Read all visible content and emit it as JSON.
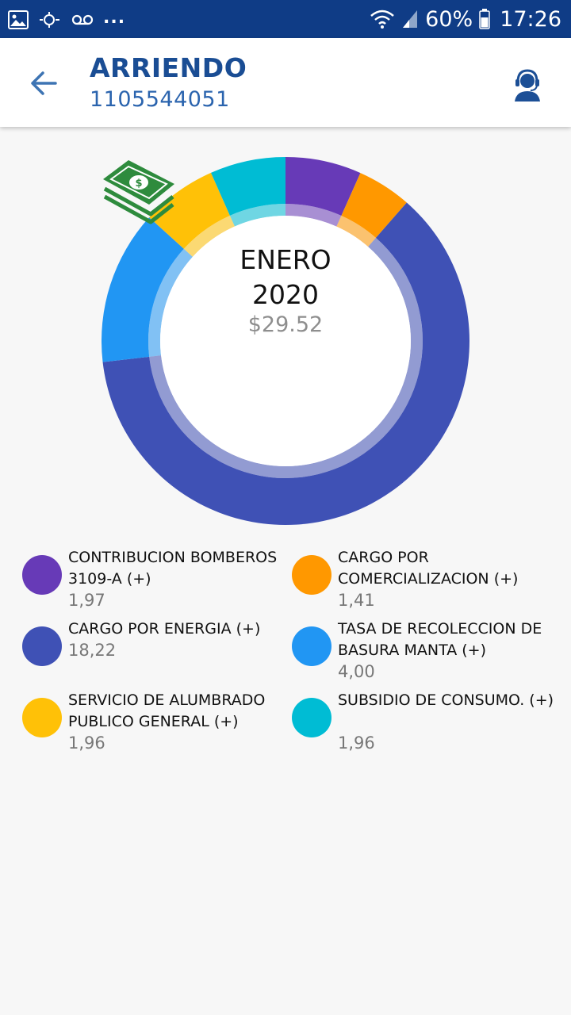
{
  "status_bar": {
    "icons_left": [
      "image-icon",
      "sync-icon",
      "voicemail-icon"
    ],
    "dots": "...",
    "battery": "60%",
    "time": "17:26"
  },
  "header": {
    "title": "ARRIENDO",
    "account": "1105544051",
    "back_icon": "arrow-left-icon",
    "support_icon": "support-agent-icon"
  },
  "summary": {
    "month": "ENERO",
    "year": "2020",
    "total": "$29.52",
    "icon": "money-stack-icon"
  },
  "chart_data": {
    "type": "pie",
    "categories": [
      "CONTRIBUCION BOMBEROS 3109-A (+)",
      "CARGO POR COMERCIALIZACION (+)",
      "CARGO POR ENERGIA (+)",
      "TASA DE RECOLECCION DE BASURA MANTA (+)",
      "SERVICIO DE ALUMBRADO PUBLICO GENERAL (+)",
      "SUBSIDIO DE CONSUMO. (+)"
    ],
    "values": [
      1.97,
      1.41,
      18.22,
      4.0,
      1.96,
      1.96
    ],
    "colors": [
      "#673ab7",
      "#ff9800",
      "#3f51b5",
      "#2196f3",
      "#ffc107",
      "#00bcd4"
    ],
    "legend": "bottom"
  },
  "legend": [
    {
      "label": "CONTRIBUCION BOMBEROS 3109-A (+)",
      "value": "1,97",
      "color": "#673ab7"
    },
    {
      "label": "CARGO POR COMERCIALIZACION (+)",
      "value": "1,41",
      "color": "#ff9800"
    },
    {
      "label": "CARGO POR ENERGIA (+)",
      "value": "18,22",
      "color": "#3f51b5"
    },
    {
      "label": "TASA DE RECOLECCION DE BASURA MANTA (+)",
      "value": "4,00",
      "color": "#2196f3"
    },
    {
      "label": "SERVICIO DE ALUMBRADO PUBLICO GENERAL (+)",
      "value": "1,96",
      "color": "#ffc107"
    },
    {
      "label": "SUBSIDIO DE CONSUMO. (+)",
      "value": "1,96",
      "color": "#00bcd4"
    }
  ]
}
